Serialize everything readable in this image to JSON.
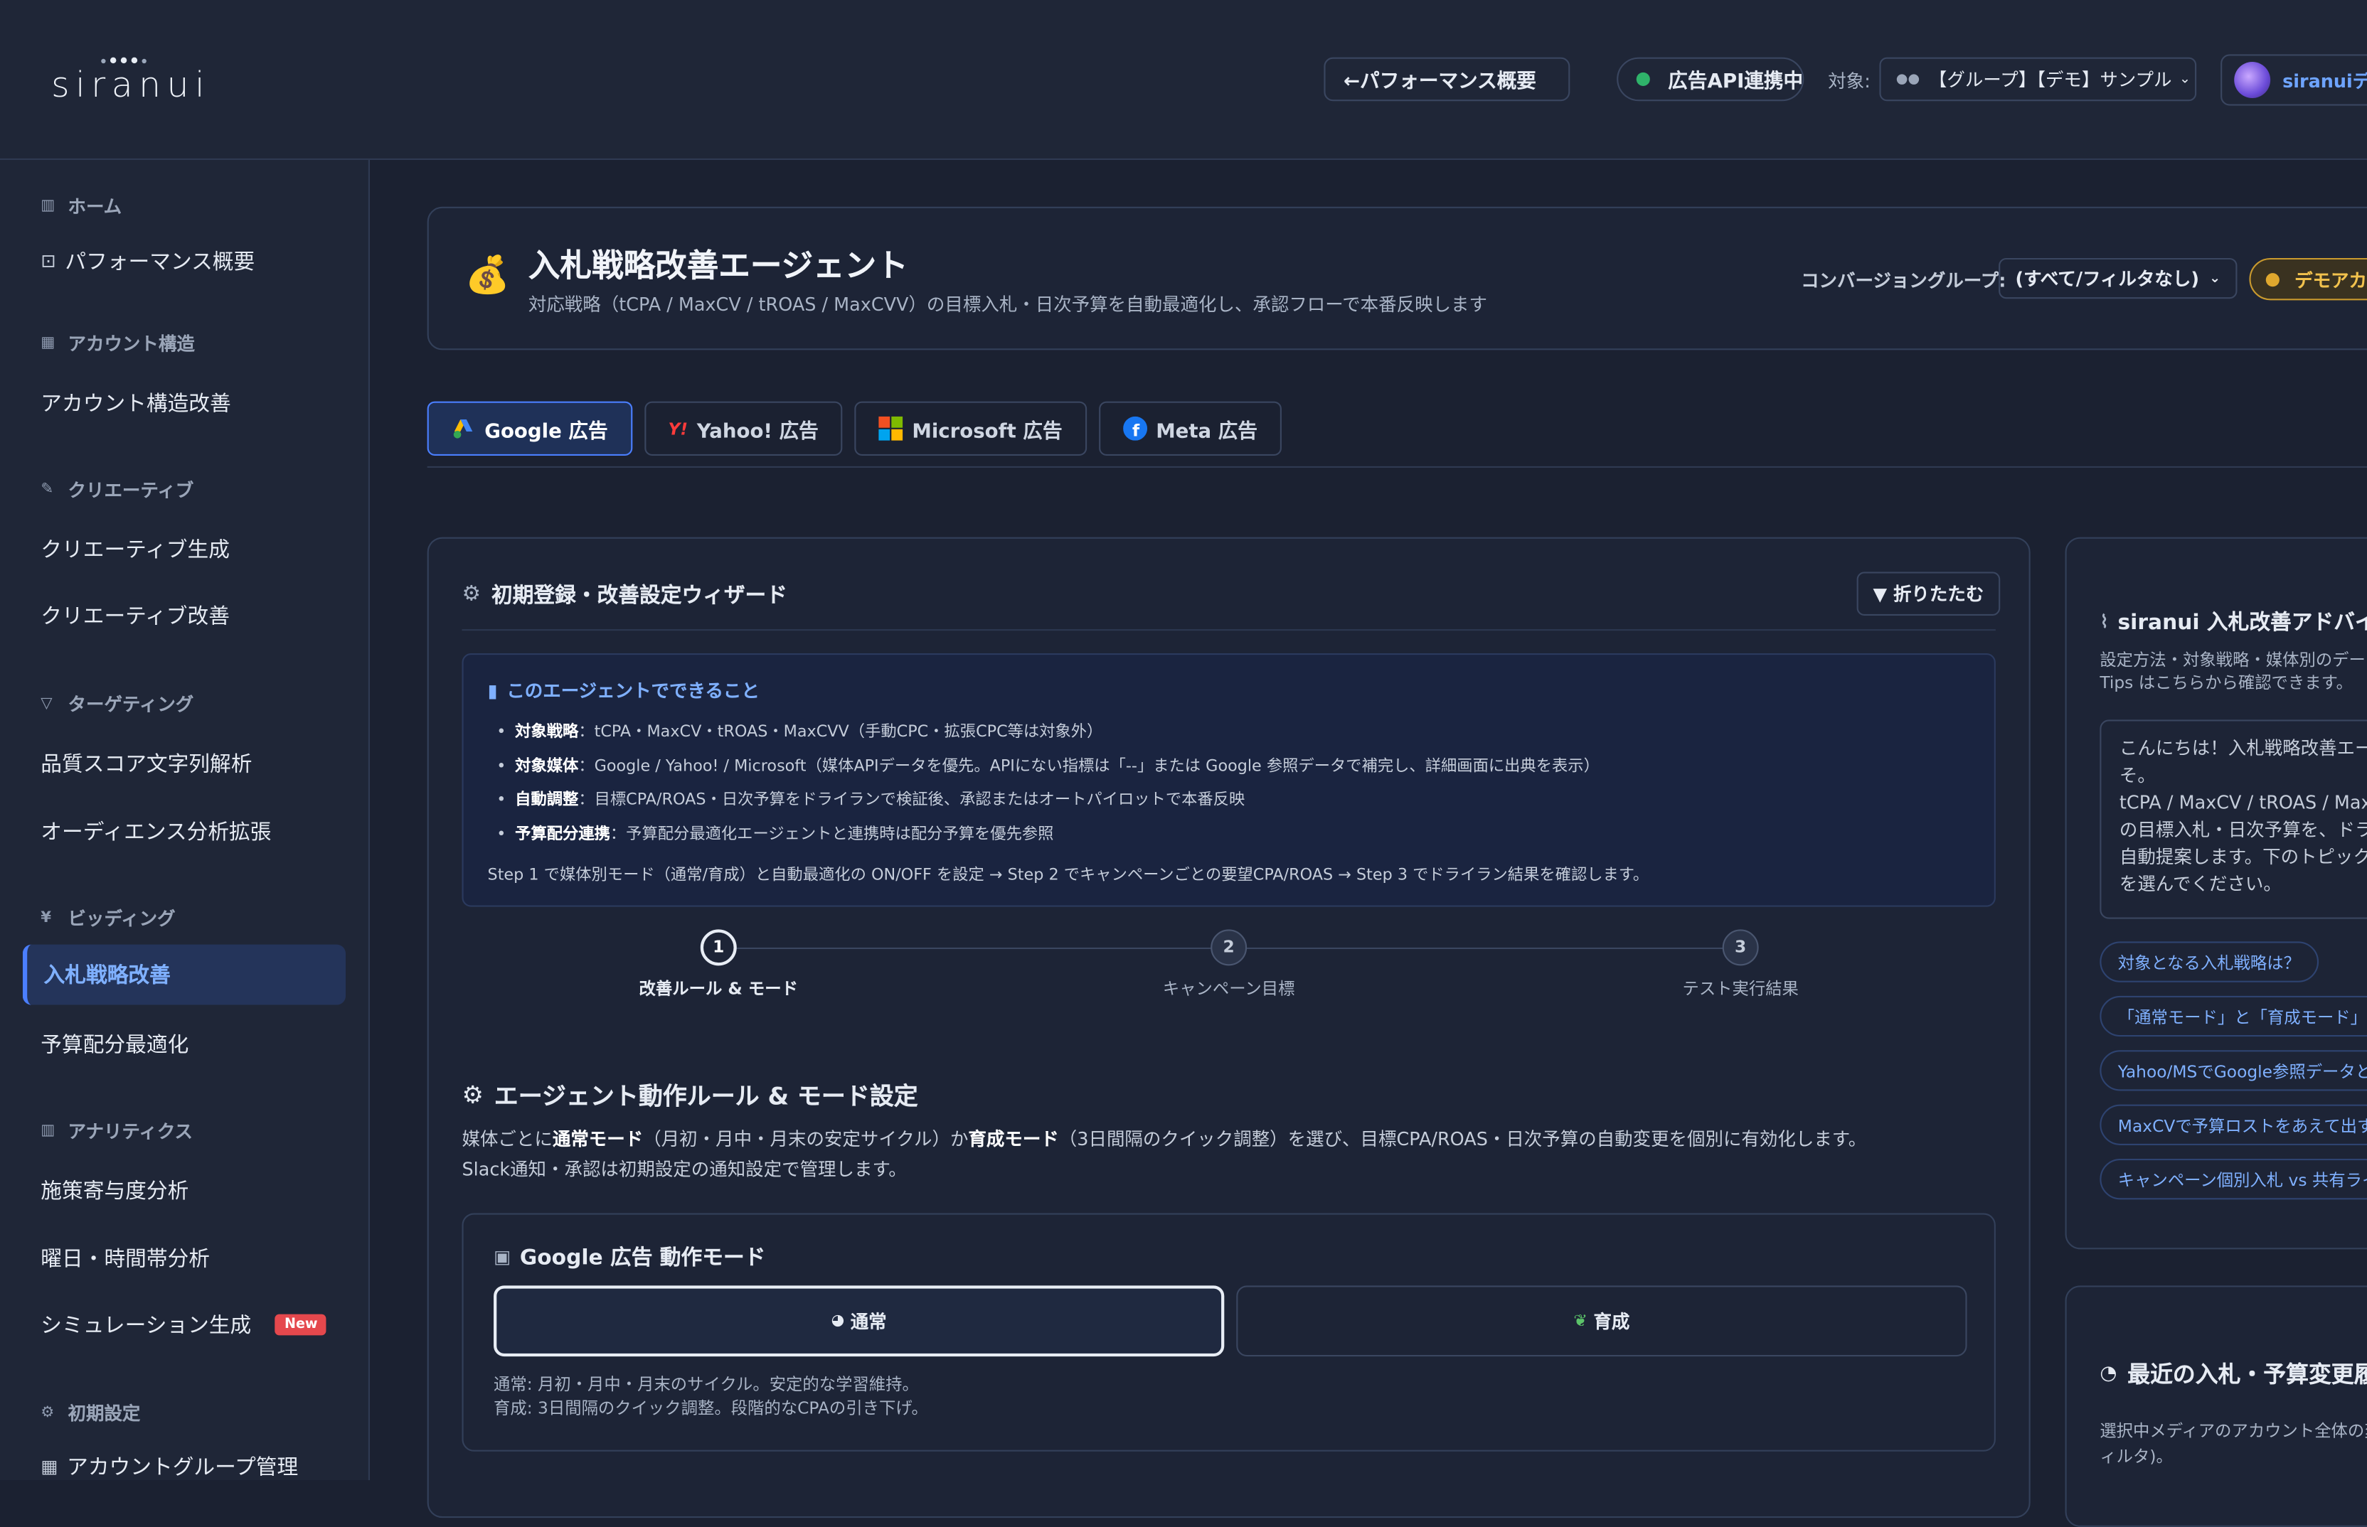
{
  "header": {
    "logo": "siranui",
    "back_button": "←パフォーマンス概要",
    "api_status": "広告API連携中",
    "target_label": "対象:",
    "target_value": "【グループ】【デモ】サンプル",
    "user_name": "siranuiデモ"
  },
  "sidebar": {
    "home": "ホーム",
    "performance": "パフォーマンス概要",
    "account_structure": "アカウント構造",
    "account_improve": "アカウント構造改善",
    "creative": "クリエーティブ",
    "creative_gen": "クリエーティブ生成",
    "creative_improve": "クリエーティブ改善",
    "targeting": "ターゲティング",
    "quality_score": "品質スコア文字列解析",
    "audience": "オーディエンス分析拡張",
    "bidding": "ビッディング",
    "bid_improve": "入札戦略改善",
    "budget_opt": "予算配分最適化",
    "analytics": "アナリティクス",
    "contribution": "施策寄与度分析",
    "day_time": "曜日・時間帯分析",
    "simulation": "シミュレーション生成",
    "new_badge": "New",
    "initial_settings": "初期設定",
    "account_group": "アカウントグループ管理"
  },
  "page": {
    "title": "入札戦略改善エージェント",
    "subtitle": "対応戦略（tCPA / MaxCV / tROAS / MaxCVV）の目標入札・日次予算を自動最適化し、承認フローで本番反映します",
    "cv_group_label": "コンバージョングループ:",
    "cv_group_value": "(すべて/フィルタなし)",
    "demo_badge": "デモアカウント"
  },
  "tabs": [
    {
      "label": "Google 広告"
    },
    {
      "label": "Yahoo! 広告"
    },
    {
      "label": "Microsoft 広告"
    },
    {
      "label": "Meta 広告"
    }
  ],
  "wizard": {
    "title": "初期登録・改善設定ウィザード",
    "collapse": "▼ 折りたたむ",
    "info_title": "このエージェントでできること",
    "info_items": [
      {
        "k": "対象戦略",
        "v": "：tCPA・MaxCV・tROAS・MaxCVV（手動CPC・拡張CPC等は対象外）"
      },
      {
        "k": "対象媒体",
        "v": "：Google / Yahoo! / Microsoft（媒体APIデータを優先。APIにない指標は「--」または Google 参照データで補完し、詳細画面に出典を表示）"
      },
      {
        "k": "自動調整",
        "v": "：目標CPA/ROAS・日次予算をドライランで検証後、承認またはオートパイロットで本番反映"
      },
      {
        "k": "予算配分連携",
        "v": "：予算配分最適化エージェントと連携時は配分予算を優先参照"
      }
    ],
    "info_footer": "Step 1 で媒体別モード（通常/育成）と自動最適化の ON/OFF を設定 → Step 2 でキャンペーンごとの要望CPA/ROAS → Step 3 でドライラン結果を確認します。",
    "steps": [
      {
        "num": "1",
        "label": "改善ルール & モード"
      },
      {
        "num": "2",
        "label": "キャンペーン目標"
      },
      {
        "num": "3",
        "label": "テスト実行結果"
      }
    ],
    "rules_title": "エージェント動作ルール & モード設定",
    "rules_desc_1": "媒体ごとに",
    "rules_desc_normal": "通常モード",
    "rules_desc_2": "（月初・月中・月末の安定サイクル）か",
    "rules_desc_grow": "育成モード",
    "rules_desc_3": "（3日間隔のクイック調整）を選び、目標CPA/ROAS・日次予算の自動変更を個別に有効化します。",
    "rules_desc_4": "Slack通知・承認は初期設定の通知設定で管理します。",
    "mode_title": "Google 広告 動作モード",
    "mode_normal": "通常",
    "mode_grow": "育成",
    "mode_note_1": "通常: 月初・月中・月末のサイクル。安定的な学習維持。",
    "mode_note_2": "育成: 3日間隔のクイック調整。段階的なCPAの引き下げ。"
  },
  "advisor": {
    "title": "siranui 入札改善アドバイザー",
    "desc": "設定方法・対象戦略・媒体別のデー\nTips はこちらから確認できます。",
    "chat": "こんにちは！入札戦略改善エー\nそ。\ntCPA / MaxCV / tROAS / Max\nの目標入札・日次予算を、ドラ\n自動提案します。下のトピック\nを選んでください。",
    "chips": [
      "対象となる入札戦略は？",
      "「通常モード」と「育成モード」",
      "Yahoo/MSでGoogle参照データと",
      "MaxCVで予算ロストをあえて出す",
      "キャンペーン個別入札 vs 共有ライブラリ"
    ]
  },
  "recent": {
    "title": "最近の入札・予算変更履歴",
    "desc": "選択中メディアのアカウント全体の変\nィルタ)。"
  }
}
